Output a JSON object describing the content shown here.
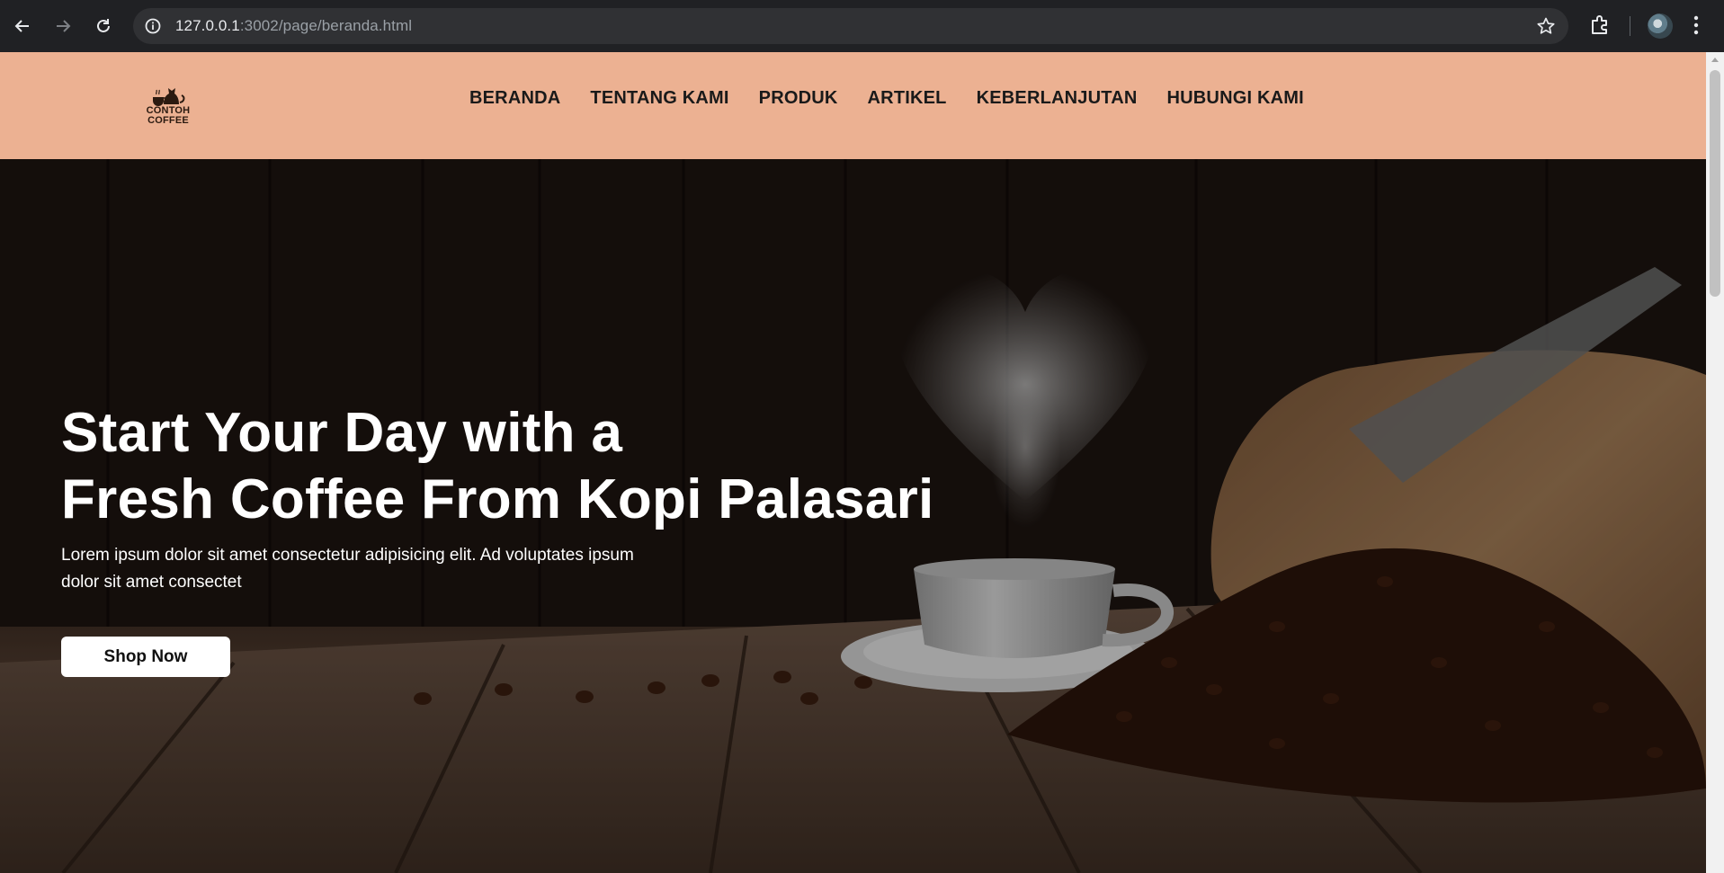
{
  "browser": {
    "url_host": "127.0.0.1",
    "url_path": ":3002/page/beranda.html"
  },
  "header": {
    "logo": {
      "line1": "CONTOH",
      "line2": "COFFEE"
    },
    "nav": [
      {
        "label": "BERANDA"
      },
      {
        "label": "TENTANG KAMI"
      },
      {
        "label": "PRODUK"
      },
      {
        "label": "ARTIKEL"
      },
      {
        "label": "KEBERLANJUTAN"
      },
      {
        "label": "HUBUNGI KAMI"
      }
    ]
  },
  "hero": {
    "title_line1": "Start Your Day with a",
    "title_line2": "Fresh Coffee From Kopi Palasari",
    "text": "Lorem ipsum dolor sit amet consectetur adipisicing elit. Ad voluptates ipsum dolor sit amet consectet",
    "button": "Shop Now"
  },
  "colors": {
    "header_bg": "#ecb192",
    "button_bg": "#ffffff",
    "chrome_bg": "#202124"
  },
  "icons": [
    "back-arrow-icon",
    "forward-arrow-icon",
    "reload-icon",
    "site-info-icon",
    "bookmark-star-icon",
    "extensions-icon",
    "profile-avatar-icon",
    "kebab-menu-icon",
    "cat-coffee-logo-icon"
  ]
}
